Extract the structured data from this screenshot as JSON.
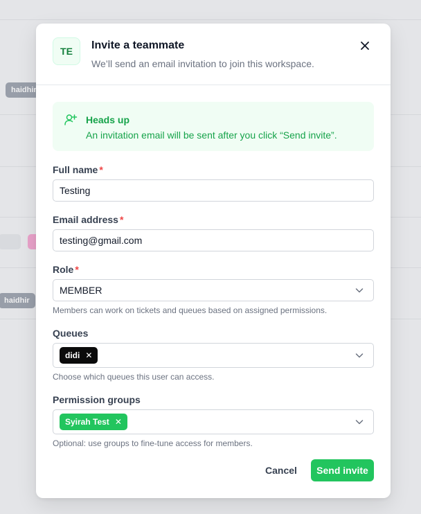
{
  "background": {
    "chips": [
      "haidhir",
      "haidhir"
    ]
  },
  "modal": {
    "avatar_initials": "TE",
    "title": "Invite a teammate",
    "subtitle": "We’ll send an email invitation to join this workspace.",
    "close_icon": "close-icon"
  },
  "banner": {
    "icon": "user-plus-icon",
    "title": "Heads up",
    "text": "An invitation email will be sent after you click “Send invite”."
  },
  "form": {
    "full_name": {
      "label": "Full name",
      "required_mark": "*",
      "value": "Testing"
    },
    "email": {
      "label": "Email address",
      "required_mark": "*",
      "value": "testing@gmail.com"
    },
    "role": {
      "label": "Role",
      "required_mark": "*",
      "value": "MEMBER",
      "help": "Members can work on tickets and queues based on assigned permissions."
    },
    "queues": {
      "label": "Queues",
      "tags": [
        "didi"
      ],
      "help": "Choose which queues this user can access."
    },
    "permission_groups": {
      "label": "Permission groups",
      "tags": [
        "Syirah Test"
      ],
      "help": "Optional: use groups to fine-tune access for members."
    }
  },
  "actions": {
    "cancel_label": "Cancel",
    "send_label": "Send invite"
  },
  "colors": {
    "accent": "#22c55e",
    "banner_bg": "#f0fdf4",
    "required": "#ef4444",
    "dark_tag": "#0b0b0b"
  }
}
